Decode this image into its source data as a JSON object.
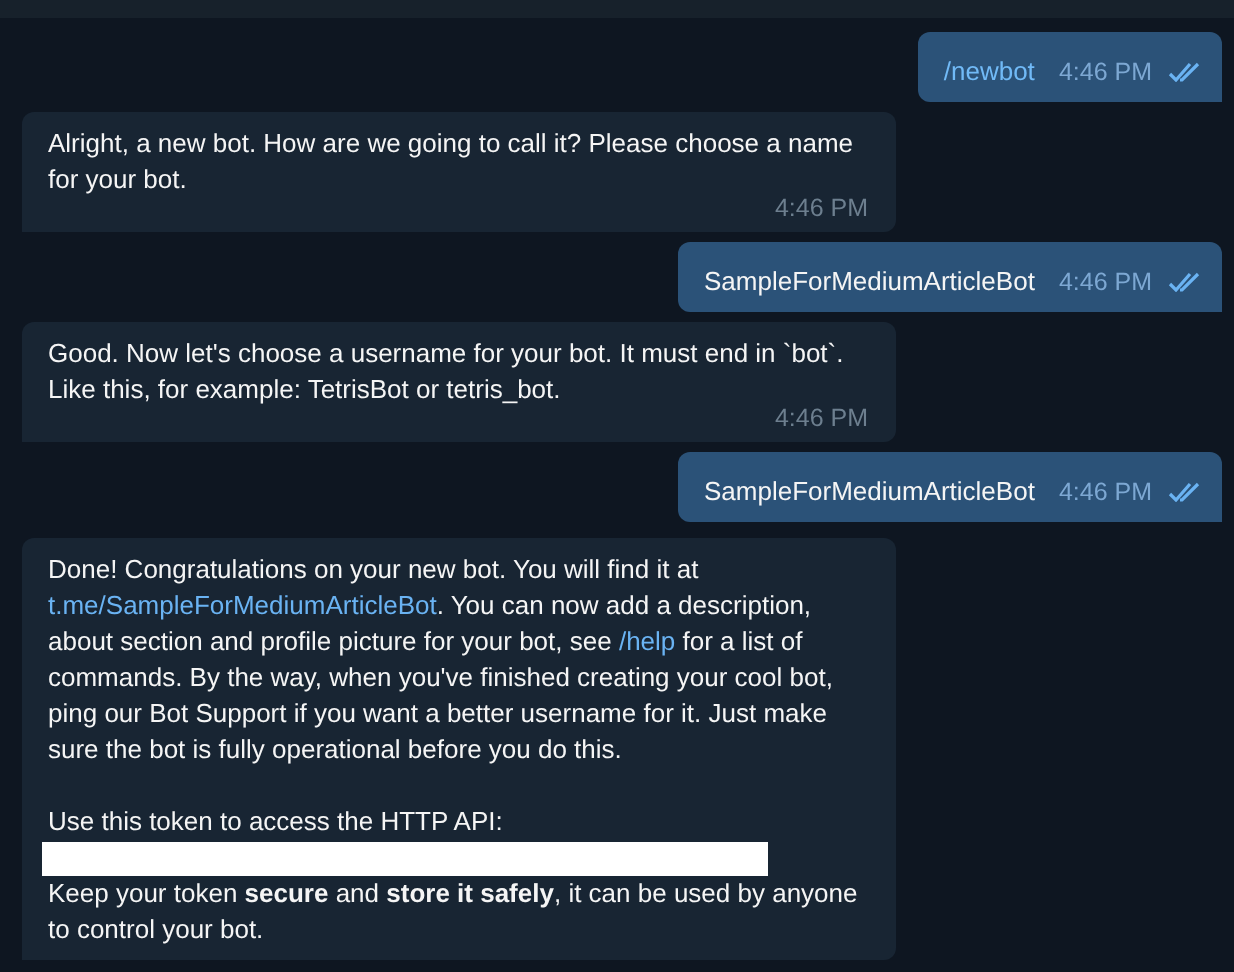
{
  "messages": [
    {
      "outgoing": true,
      "kind": "command",
      "text": "/newbot",
      "time": "4:46 PM",
      "read": true
    },
    {
      "outgoing": false,
      "kind": "text",
      "text": "Alright, a new bot. How are we going to call it? Please choose a name for your bot.",
      "time": "4:46 PM"
    },
    {
      "outgoing": true,
      "kind": "text",
      "text": "SampleForMediumArticleBot",
      "time": "4:46 PM",
      "read": true
    },
    {
      "outgoing": false,
      "kind": "text",
      "text": "Good. Now let's choose a username for your bot. It must end in `bot`. Like this, for example: TetrisBot or tetris_bot.",
      "time": "4:46 PM"
    },
    {
      "outgoing": true,
      "kind": "text",
      "text": "SampleForMediumArticleBot",
      "time": "4:46 PM",
      "read": true
    },
    {
      "outgoing": false,
      "kind": "rich",
      "paragraphs": [
        {
          "kind": "segments",
          "segments": [
            {
              "kind": "plain",
              "text": "Done! Congratulations on your new bot. You will find it at "
            },
            {
              "kind": "link",
              "text": "t.me/SampleForMediumArticleBot"
            },
            {
              "kind": "plain",
              "text": ". You can now add a description, about section and profile picture for your bot, see "
            },
            {
              "kind": "link",
              "text": "/help"
            },
            {
              "kind": "plain",
              "text": " for a list of commands. By the way, when you've finished creating your cool bot, ping our Bot Support if you want a better username for it. Just make sure the bot is fully operational before you do this."
            }
          ]
        },
        {
          "kind": "text",
          "text": "Use this token to access the HTTP API:"
        },
        {
          "kind": "redacted"
        },
        {
          "kind": "text",
          "text": "Keep your token **secure** and **store it safely**, it can be used by anyone to control your bot."
        }
      ]
    }
  ]
}
